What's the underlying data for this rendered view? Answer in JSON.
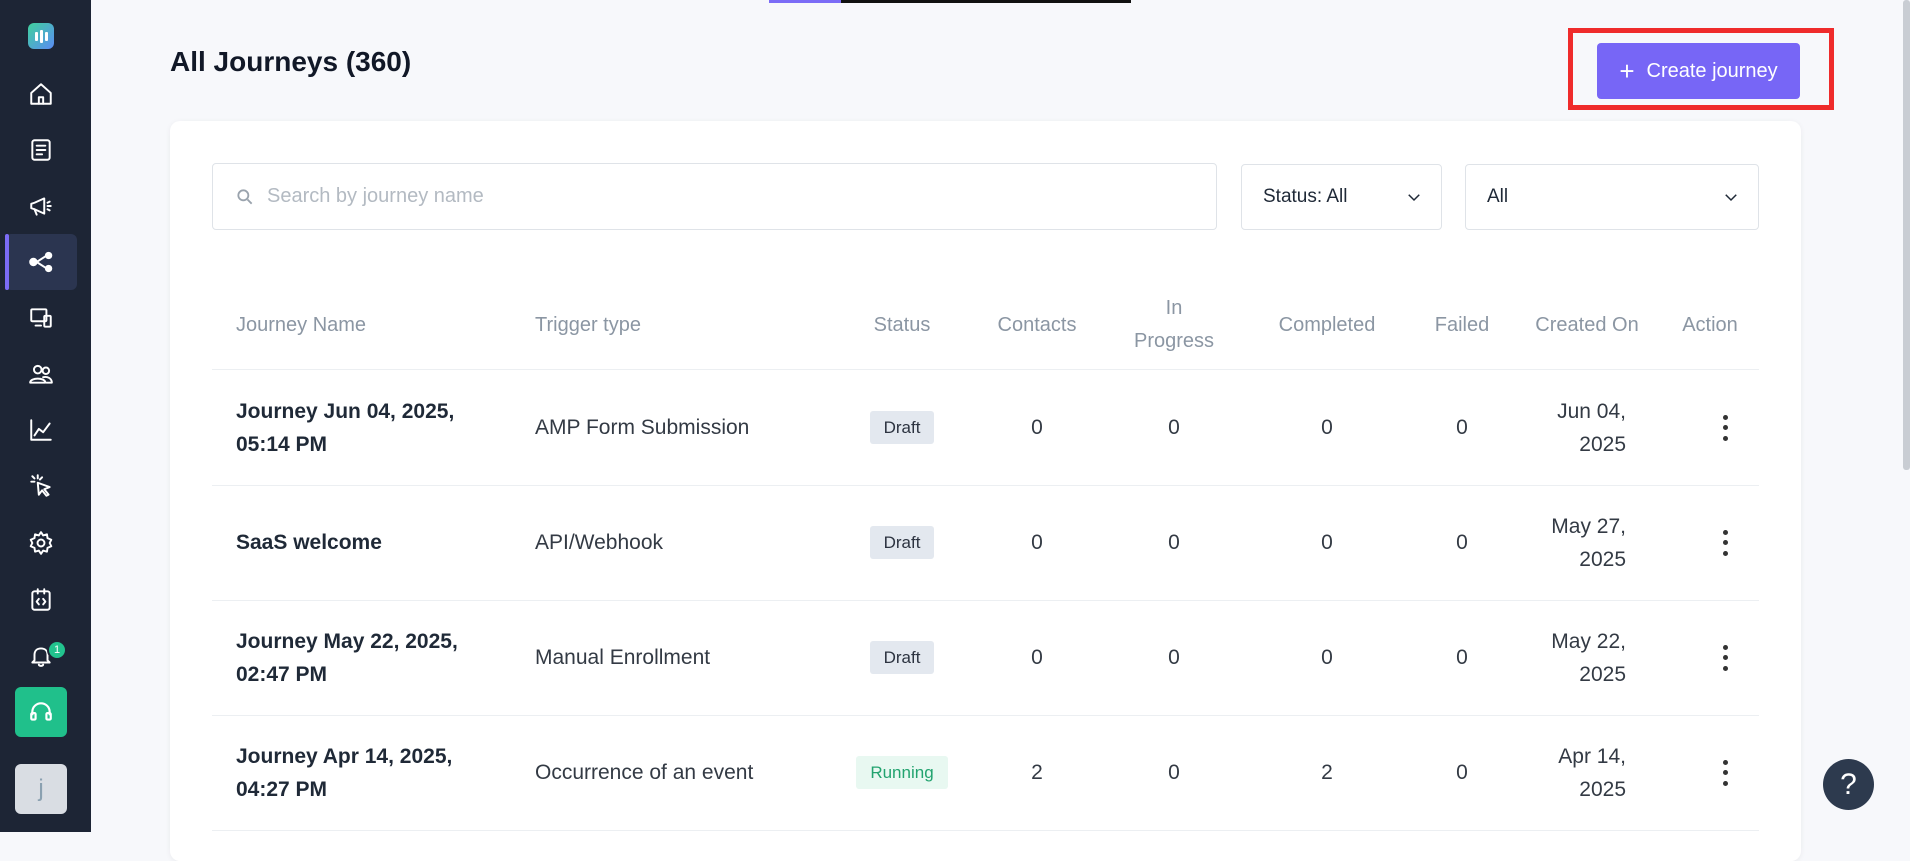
{
  "sidebar": {
    "icons": [
      "app-logo",
      "home-icon",
      "clipboard-icon",
      "megaphone-icon",
      "journey-icon",
      "screen-icon",
      "users-icon",
      "chart-icon",
      "cursor-click-icon",
      "gear-icon",
      "code-icon",
      "bell-icon",
      "headset-icon"
    ],
    "active": "journey-icon",
    "notification_count": "1",
    "avatar_initial": "j"
  },
  "header": {
    "title": "All Journeys (360)",
    "create_label": "Create journey"
  },
  "filters": {
    "search_placeholder": "Search by journey name",
    "status_label": "Status: All",
    "type_label": "All"
  },
  "table": {
    "columns": {
      "name": "Journey Name",
      "trigger": "Trigger type",
      "status": "Status",
      "contacts": "Contacts",
      "in_progress_1": "In",
      "in_progress_2": "Progress",
      "completed": "Completed",
      "failed": "Failed",
      "created": "Created On",
      "action": "Action"
    },
    "rows": [
      {
        "name_1": "Journey Jun 04, 2025,",
        "name_2": "05:14 PM",
        "trigger": "AMP Form Submission",
        "status": "Draft",
        "contacts": "0",
        "in_progress": "0",
        "completed": "0",
        "failed": "0",
        "created_1": "Jun 04,",
        "created_2": "2025"
      },
      {
        "name_1": "SaaS welcome",
        "name_2": "",
        "trigger": "API/Webhook",
        "status": "Draft",
        "contacts": "0",
        "in_progress": "0",
        "completed": "0",
        "failed": "0",
        "created_1": "May 27,",
        "created_2": "2025"
      },
      {
        "name_1": "Journey May 22, 2025,",
        "name_2": "02:47 PM",
        "trigger": "Manual Enrollment",
        "status": "Draft",
        "contacts": "0",
        "in_progress": "0",
        "completed": "0",
        "failed": "0",
        "created_1": "May 22,",
        "created_2": "2025"
      },
      {
        "name_1": "Journey Apr 14, 2025,",
        "name_2": "04:27 PM",
        "trigger": "Occurrence of an event",
        "status": "Running",
        "contacts": "2",
        "in_progress": "0",
        "completed": "2",
        "failed": "0",
        "created_1": "Apr 14,",
        "created_2": "2025"
      }
    ]
  },
  "colors": {
    "sidebar_bg": "#1d2535",
    "accent": "#7766f6",
    "highlight": "#ef2b2b",
    "running": "#22a36f"
  },
  "help_label": "?"
}
